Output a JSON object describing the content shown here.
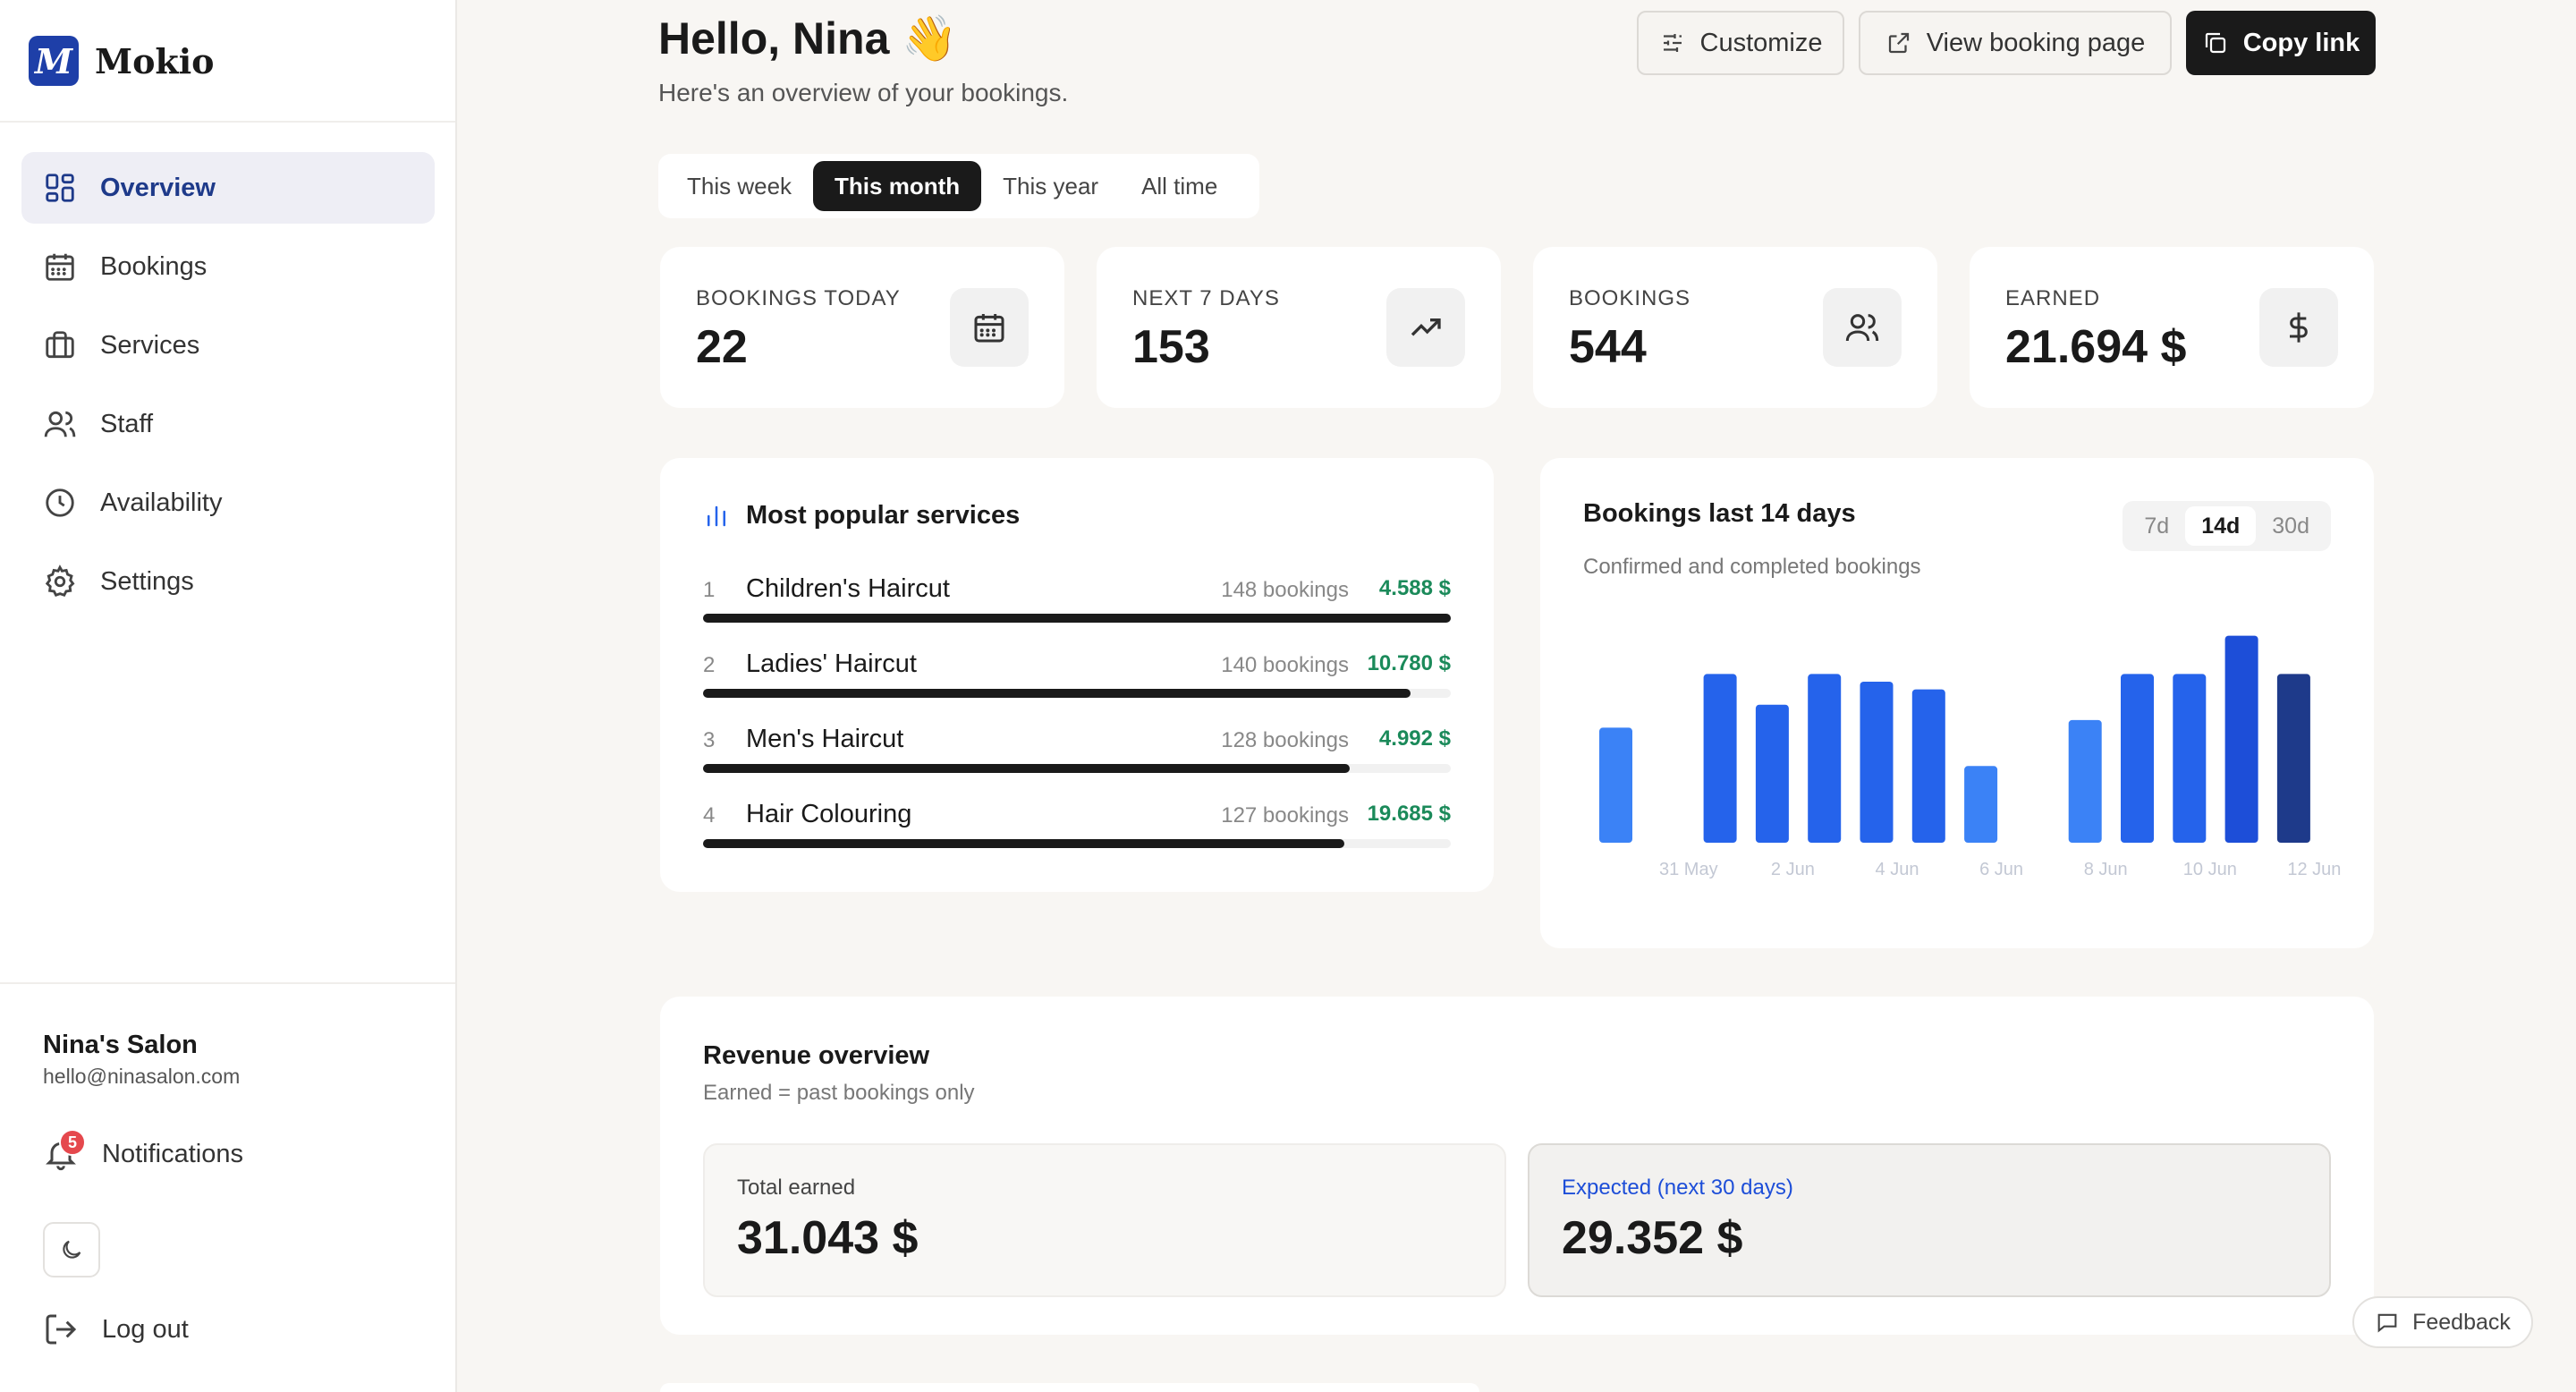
{
  "brand": {
    "mark": "M",
    "name": "Mokio"
  },
  "nav": [
    {
      "label": "Overview",
      "icon": "grid-icon",
      "active": true
    },
    {
      "label": "Bookings",
      "icon": "calendar-icon",
      "active": false
    },
    {
      "label": "Services",
      "icon": "briefcase-icon",
      "active": false
    },
    {
      "label": "Staff",
      "icon": "users-icon",
      "active": false
    },
    {
      "label": "Availability",
      "icon": "clock-icon",
      "active": false
    },
    {
      "label": "Settings",
      "icon": "gear-icon",
      "active": false
    }
  ],
  "account": {
    "name": "Nina's Salon",
    "email": "hello@ninasalon.com"
  },
  "notifications": {
    "label": "Notifications",
    "count": "5"
  },
  "logout_label": "Log out",
  "header": {
    "greeting": "Hello, Nina 👋",
    "subtitle": "Here's an overview of your bookings.",
    "customize_label": "Customize",
    "view_page_label": "View booking page",
    "copy_link_label": "Copy link"
  },
  "period_tabs": [
    {
      "label": "This week",
      "active": false
    },
    {
      "label": "This month",
      "active": true
    },
    {
      "label": "This year",
      "active": false
    },
    {
      "label": "All time",
      "active": false
    }
  ],
  "stats": [
    {
      "label": "BOOKINGS TODAY",
      "value": "22",
      "icon": "calendar-icon"
    },
    {
      "label": "NEXT 7 DAYS",
      "value": "153",
      "icon": "trending-up-icon"
    },
    {
      "label": "BOOKINGS",
      "value": "544",
      "icon": "users-icon"
    },
    {
      "label": "EARNED",
      "value": "21.694 $",
      "icon": "dollar-icon"
    }
  ],
  "popular": {
    "title": "Most popular services",
    "items": [
      {
        "rank": "1",
        "name": "Children's Haircut",
        "bookings": "148 bookings",
        "amount": "4.588 $",
        "share": 1.0
      },
      {
        "rank": "2",
        "name": "Ladies' Haircut",
        "bookings": "140 bookings",
        "amount": "10.780 $",
        "share": 0.946
      },
      {
        "rank": "3",
        "name": "Men's Haircut",
        "bookings": "128 bookings",
        "amount": "4.992 $",
        "share": 0.865
      },
      {
        "rank": "4",
        "name": "Hair Colouring",
        "bookings": "127 bookings",
        "amount": "19.685 $",
        "share": 0.858
      }
    ]
  },
  "bookings_chart": {
    "title": "Bookings last 14 days",
    "subtitle": "Confirmed and completed bookings",
    "ranges": [
      {
        "label": "7d",
        "active": false
      },
      {
        "label": "14d",
        "active": true
      },
      {
        "label": "30d",
        "active": false
      }
    ]
  },
  "chart_data": {
    "type": "bar",
    "categories": [
      "30 May",
      "31 May",
      "1 Jun",
      "2 Jun",
      "3 Jun",
      "4 Jun",
      "5 Jun",
      "6 Jun",
      "7 Jun",
      "8 Jun",
      "9 Jun",
      "10 Jun",
      "11 Jun",
      "12 Jun"
    ],
    "tick_labels": [
      "",
      "31 May",
      "",
      "2 Jun",
      "",
      "4 Jun",
      "",
      "6 Jun",
      "",
      "8 Jun",
      "",
      "10 Jun",
      "",
      "12 Jun"
    ],
    "values": [
      30,
      0,
      44,
      36,
      44,
      42,
      40,
      20,
      0,
      32,
      44,
      44,
      54,
      44
    ],
    "ylim": [
      0,
      56
    ],
    "bar_colors": [
      "#3b82f6",
      "#2563eb",
      "#2563eb",
      "#2563eb",
      "#2563eb",
      "#2563eb",
      "#2563eb",
      "#3b82f6",
      "#3b82f6",
      "#3b82f6",
      "#2563eb",
      "#2563eb",
      "#1d4ed8",
      "#1e3a8a"
    ],
    "grid": false
  },
  "revenue": {
    "title": "Revenue overview",
    "subtitle": "Earned = past bookings only",
    "total_label": "Total earned",
    "total_value": "31.043 $",
    "expected_label": "Expected (next 30 days)",
    "expected_value": "29.352 $"
  },
  "feedback_label": "Feedback",
  "colors": {
    "accent": "#1e3fa8",
    "nav_active": "#1e3a8a",
    "money": "#1b8a5a",
    "expected": "#1d4ed8"
  }
}
